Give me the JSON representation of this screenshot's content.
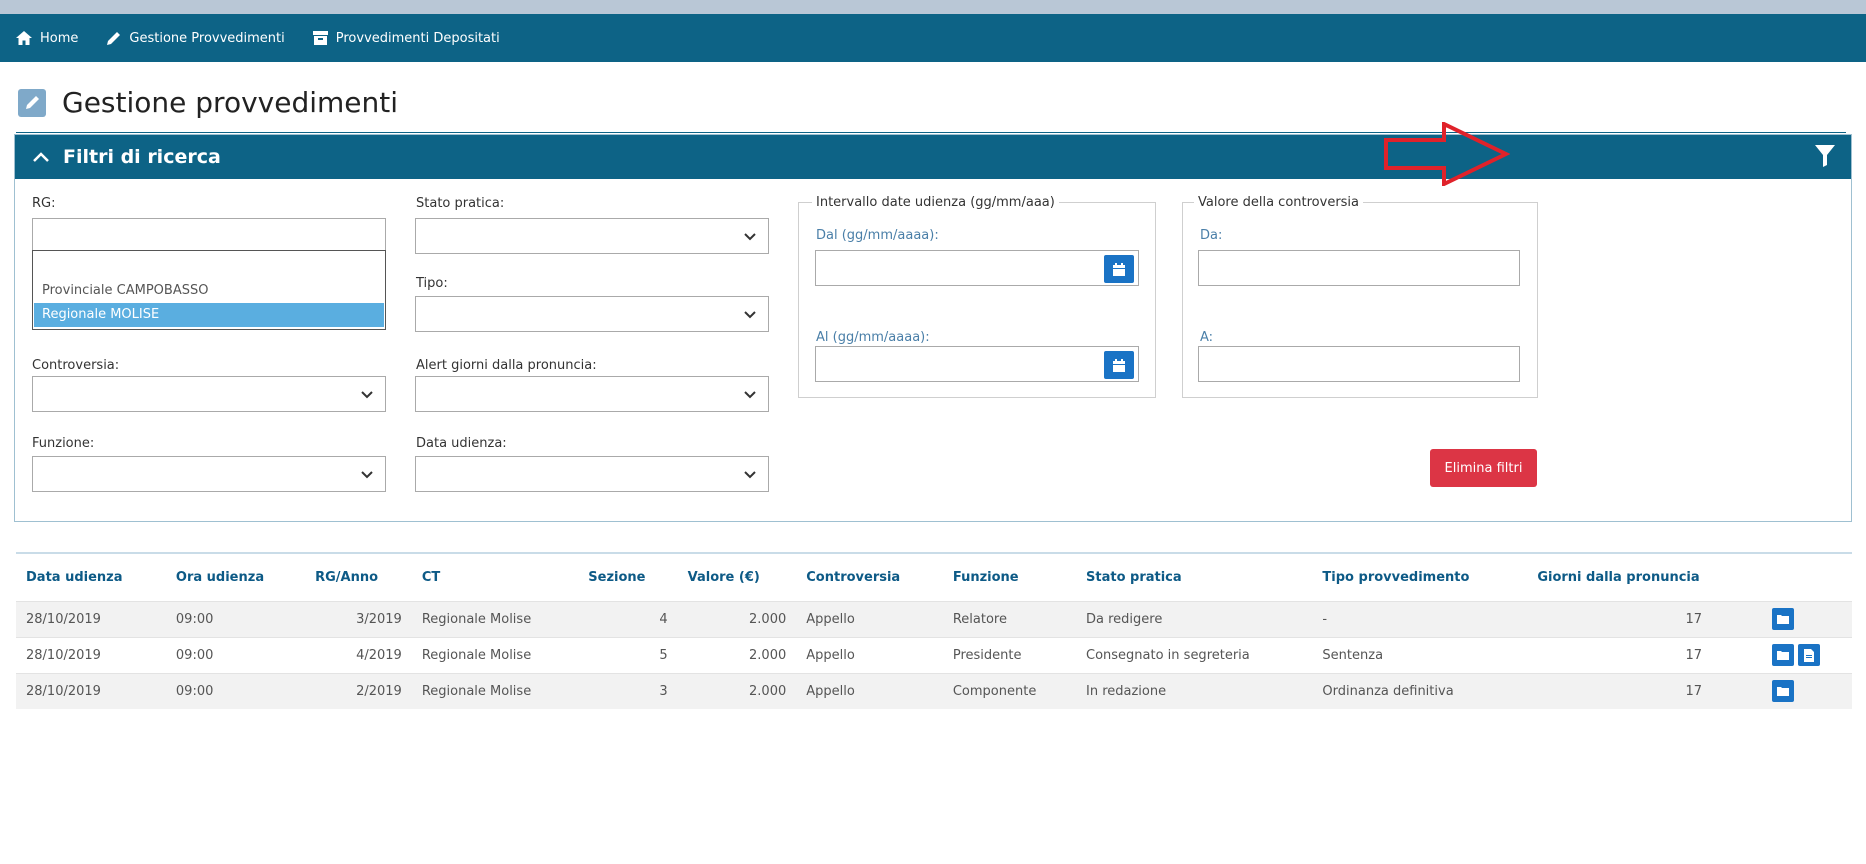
{
  "nav": {
    "home": "Home",
    "gestione": "Gestione Provvedimenti",
    "depositati": "Provvedimenti Depositati"
  },
  "page_title": "Gestione provvedimenti",
  "filters": {
    "title": "Filtri di ricerca",
    "rg_label": "RG:",
    "rg_value": "",
    "rg_options": [
      "Provinciale CAMPOBASSO",
      "Regionale MOLISE"
    ],
    "rg_selected": "Regionale MOLISE",
    "stato_label": "Stato pratica:",
    "tipo_label": "Tipo:",
    "controversia_label": "Controversia:",
    "alert_label": "Alert giorni dalla pronuncia:",
    "funzione_label": "Funzione:",
    "data_udienza_label": "Data udienza:",
    "intervallo_legend": "Intervallo date udienza (gg/mm/aaa)",
    "dal_label": "Dal (gg/mm/aaaa):",
    "al_label": "Al (gg/mm/aaaa):",
    "valore_legend": "Valore della controversia",
    "da_label": "Da:",
    "a_label": "A:",
    "elimina_button": "Elimina filtri"
  },
  "table": {
    "headers": [
      "Data udienza",
      "Ora udienza",
      "RG/Anno",
      "CT",
      "Sezione",
      "Valore (€)",
      "Controversia",
      "Funzione",
      "Stato pratica",
      "Tipo provvedimento",
      "Giorni dalla pronuncia"
    ],
    "rows": [
      {
        "data": "28/10/2019",
        "ora": "09:00",
        "rg": "3/2019",
        "ct": "Regionale Molise",
        "sezione": "4",
        "valore": "2.000",
        "controversia": "Appello",
        "funzione": "Relatore",
        "stato": "Da redigere",
        "tipo": "-",
        "giorni": "17"
      },
      {
        "data": "28/10/2019",
        "ora": "09:00",
        "rg": "4/2019",
        "ct": "Regionale Molise",
        "sezione": "5",
        "valore": "2.000",
        "controversia": "Appello",
        "funzione": "Presidente",
        "stato": "Consegnato in segreteria",
        "tipo": "Sentenza",
        "giorni": "17"
      },
      {
        "data": "28/10/2019",
        "ora": "09:00",
        "rg": "2/2019",
        "ct": "Regionale Molise",
        "sezione": "3",
        "valore": "2.000",
        "controversia": "Appello",
        "funzione": "Componente",
        "stato": "In redazione",
        "tipo": "Ordinanza definitiva",
        "giorni": "17"
      }
    ]
  },
  "colors": {
    "navbar": "#0d6386",
    "accent_blue": "#1a73c5",
    "danger": "#dc3545",
    "annotation_arrow": "#e0222a"
  },
  "icons": [
    "home-icon",
    "pencil-icon",
    "box-icon",
    "edit-icon",
    "chevron-up-icon",
    "filter-icon",
    "calendar-icon",
    "folder-icon",
    "document-icon",
    "chevron-down-icon"
  ]
}
